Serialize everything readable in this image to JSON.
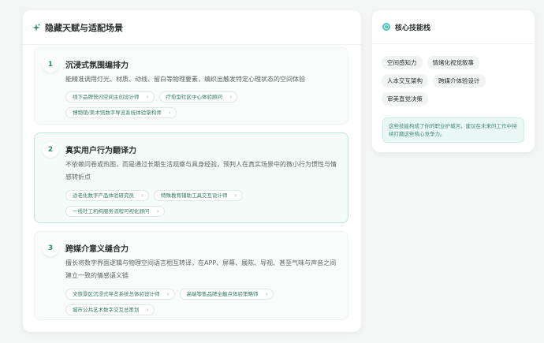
{
  "left_panel": {
    "title": "隐藏天赋与适配场景",
    "items": [
      {
        "number": "1",
        "title": "沉浸式氛围编排力",
        "description": "能精准调用灯光、材质、动线、留白等物理要素，编织出触发特定心理状态的空间体验",
        "tags": [
          "线下品牌快闪空间主创设计师",
          "疗愈型社区中心体验顾问",
          "博物馆/美术馆数字导览系统体验架构师"
        ]
      },
      {
        "number": "2",
        "title": "真实用户行为翻译力",
        "description": "不依赖问卷或热图，而是通过长期生活观察与具身经验，预判人在真实场景中的微小行为惯性与情感转折点",
        "tags": [
          "适老化数字产品体验研究员",
          "特殊教育辅助工具交互设计师",
          "一线社工机构服务流程可视化顾问"
        ]
      },
      {
        "number": "3",
        "title": "跨媒介意义缝合力",
        "description": "擅长将数字界面逻辑与物理空间语言相互转译，在APP、屏幕、展陈、导视、甚至气味与声音之间建立一致的情感语义链",
        "tags": [
          "文旅景区沉浸式导览系统总体验设计师",
          "高端零售品牌全触点体验策略师",
          "城市公共艺术数字交互总策划"
        ]
      }
    ]
  },
  "right_panel": {
    "title": "核心技能栈",
    "skills": [
      "空间感知力",
      "情绪化视觉叙事",
      "人本交互架构",
      "跨媒介体验设计",
      "审美直觉决策"
    ],
    "note": "这些技能构成了你的职业护城河，建议在未来的工作中持续打磨这些核心竞争力。"
  },
  "colors": {
    "accent": "#2f8a6c",
    "active_border": "#bfe6d8",
    "note_bg": "#eaf8f5",
    "icon_teal": "#4cc6b8"
  }
}
